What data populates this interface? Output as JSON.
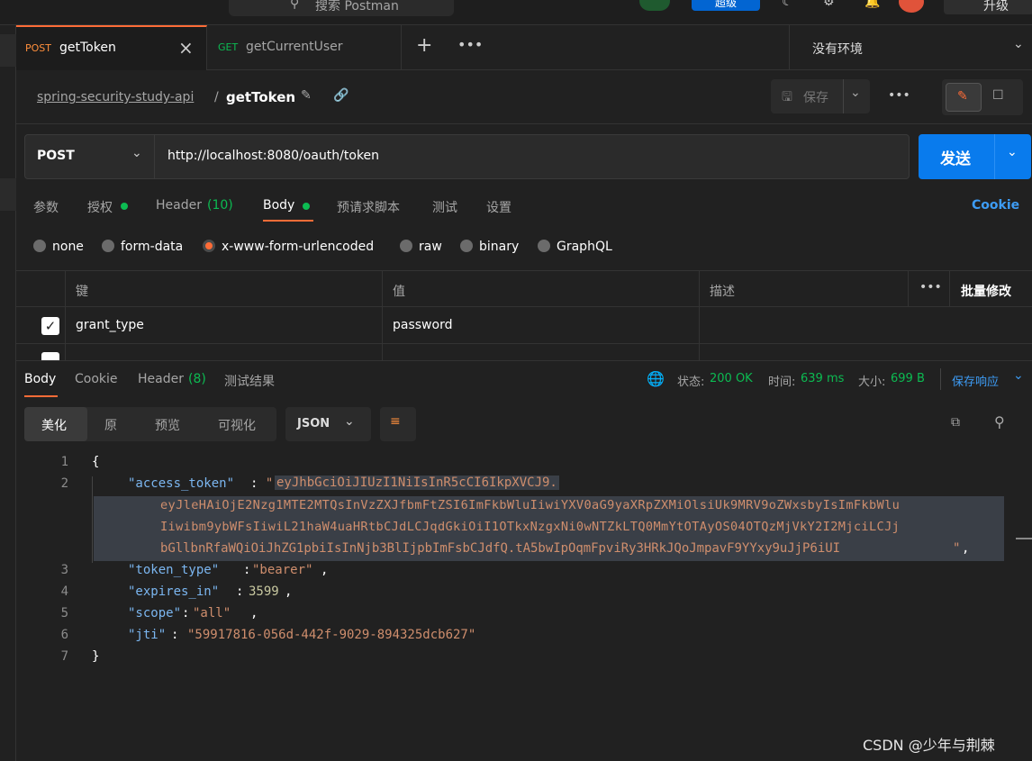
{
  "topbar": {
    "search_placeholder": "搜索 Postman",
    "upgrade_label": "超级",
    "partial_right": "升级"
  },
  "tabs": [
    {
      "method": "POST",
      "name": "getToken",
      "active": true
    },
    {
      "method": "GET",
      "name": "getCurrentUser",
      "active": false
    }
  ],
  "environment": "没有环境",
  "breadcrumb": {
    "collection": "spring-security-study-api",
    "separator": "/",
    "request": "getToken"
  },
  "save_label": "保存",
  "request": {
    "method": "POST",
    "url": "http://localhost:8080/oauth/token",
    "send_label": "发送"
  },
  "req_tabs": {
    "params": "参数",
    "auth": "授权",
    "header": "Header",
    "header_count": "(10)",
    "body": "Body",
    "prescript": "预请求脚本",
    "tests": "测试",
    "settings": "设置",
    "cookie": "Cookie"
  },
  "body_types": [
    "none",
    "form-data",
    "x-www-form-urlencoded",
    "raw",
    "binary",
    "GraphQL"
  ],
  "table": {
    "col_key": "键",
    "col_value": "值",
    "col_desc": "描述",
    "bulk_edit": "批量修改",
    "rows": [
      {
        "key": "grant_type",
        "value": "password"
      }
    ]
  },
  "response": {
    "tab_body": "Body",
    "tab_cookie": "Cookie",
    "tab_header": "Header",
    "header_count": "(8)",
    "tab_tests": "测试结果",
    "status_label": "状态:",
    "status": "200 OK",
    "time_label": "时间:",
    "time": "639 ms",
    "size_label": "大小:",
    "size": "699 B",
    "save_response": "保存响应",
    "view_modes": [
      "美化",
      "原",
      "预览",
      "可视化"
    ],
    "format": "JSON"
  },
  "json_lines": {
    "l1": "{",
    "access_key": "\"access_token\"",
    "access_v1": "eyJhbGciOiJIUzI1NiIsInR5cCI6IkpXVCJ9.",
    "access_v2": "eyJleHAiOjE2Nzg1MTE2MTQsInVzZXJfbmFtZSI6ImFkbWluIiwiYXV0aG9yaXRpZXMiOlsiUk9MRV9oZWxsbyIsImFkbWlu",
    "access_v3": "Iiwibm9ybWFsIiwiL21haW4uaHRtbCJdLCJqdGkiOiI1OTkxNzgxNi0wNTZkLTQ0MmYtOTAyOS04OTQzMjVkY2I2MjciLCJj",
    "access_v4": "bGllbnRfaWQiOiJhZG1pbiIsInNjb3BlIjpbImFsbCJdfQ.tA5bwIpOqmFpviRy3HRkJQoJmpavF9YYxy9uJjP6iUI",
    "token_type_key": "\"token_type\"",
    "token_type_val": "\"bearer\"",
    "expires_key": "\"expires_in\"",
    "expires_val": "3599",
    "scope_key": "\"scope\"",
    "scope_val": "\"all\"",
    "jti_key": "\"jti\"",
    "jti_val": "\"59917816-056d-442f-9029-894325dcb627\"",
    "l7": "}"
  },
  "watermark": "CSDN @少年与荆棘"
}
